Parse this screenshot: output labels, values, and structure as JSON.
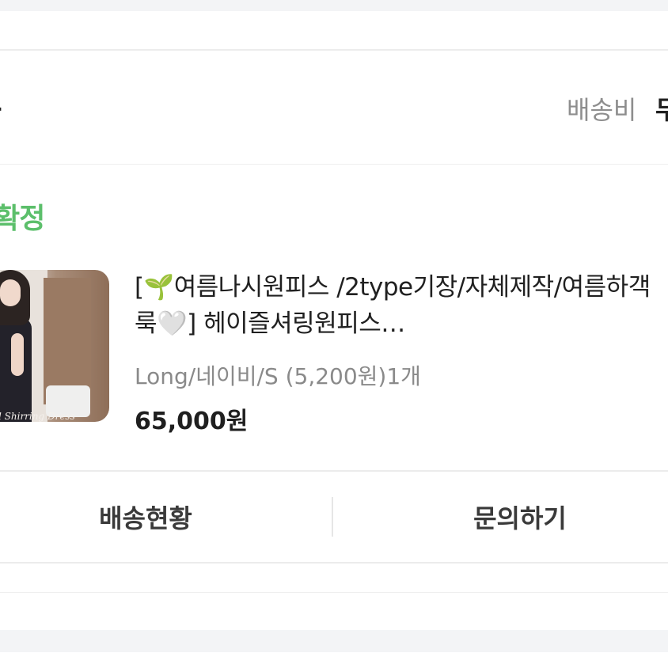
{
  "seller": {
    "name_partial": "는",
    "shipping_label": "배송비",
    "shipping_value_partial": "무"
  },
  "order": {
    "status_partial": "배확정",
    "status_color": "#5cbf6b"
  },
  "product": {
    "title_prefix": "[",
    "sprout_icon": "🌱",
    "title_part1": "여름나시원피스 /2type기장/자체제작/여름하객룩",
    "heart_icon": "🤍",
    "title_part2": "] 헤이즐셔링원피스…",
    "option": "Long/네이비/S (5,200원)1개",
    "price": "65,000원",
    "thumbnail_caption": "l Shirring Dress"
  },
  "actions": {
    "track_label": "배송현황",
    "inquiry_label": "문의하기"
  }
}
